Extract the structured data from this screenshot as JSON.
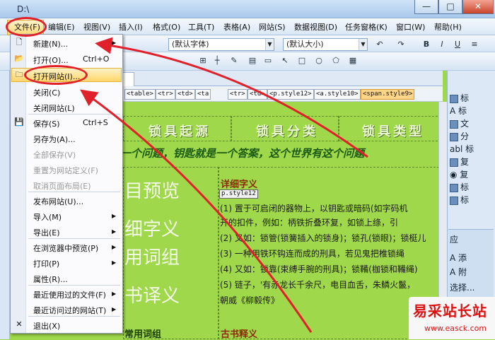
{
  "window": {
    "title": "D:\\",
    "min": "—",
    "max": "□",
    "close": "✕"
  },
  "menu": {
    "file": "文件(F)",
    "edit": "编辑(E)",
    "view": "视图(V)",
    "insert": "插入(I)",
    "format": "格式(O)",
    "tools": "工具(T)",
    "table": "表格(A)",
    "website": "网站(S)",
    "dataview": "数据视图(D)",
    "taskpane": "任务窗格(K)",
    "window": "窗口(W)",
    "help": "帮助(H)"
  },
  "toolbar": {
    "font_default": "(默认字体)",
    "size_default": "(默认大小)",
    "bold": "B",
    "italic": "I",
    "underline": "U"
  },
  "doc_tab": "htm",
  "tags": [
    "<table>",
    "<tr>",
    "<td>",
    "<ta",
    "<tr>",
    "<td>",
    "<p.style12>",
    "<a.style10>",
    "<span.style9>"
  ],
  "page": {
    "headers": [
      "锁具起源",
      "锁具分类",
      "锁具类型"
    ],
    "marquee": "一个问题，钥匙就是一个答案，这个世界有这个问题",
    "left_labels": [
      "目预览",
      "细字义",
      "用词组",
      "书译义",
      "常用词组"
    ],
    "right_title": "详细字义",
    "style_tag": "p.style12",
    "lines": [
      "(1) 置于可启闭的器物上，以钥匙或暗码(如字码机",
      "开的扣件，例如：柄铁折叠环复，如锁上绦，引",
      "(2) 又如：锁管(锁簧插入的锁身)；锁孔(锁眼)；锁梃儿",
      "(3) 一种用铁环钩连而成的刑具，若见鬼把椎锁绳",
      "(4) 又如：锁靠(束缚手腕的刑具)；锁鞴(枷锁和鞴绳)",
      "(5) 链子，'有赤龙长千余尺，电目血舌，朱鳞火鬣，",
      "朝威《柳毅传》"
    ],
    "bottom_title": "古书释义"
  },
  "dock": {
    "items": [
      "标",
      "A 标",
      "文",
      "分",
      "abl 标",
      "复",
      "◉ 复",
      "标",
      "标"
    ],
    "panel2": [
      "应",
      "A 添",
      "A 附",
      "选择..."
    ]
  },
  "file_menu": {
    "new": "新建(N)...",
    "open": "打开(O)...",
    "open_shortcut": "Ctrl+O",
    "open_site": "打开网站(I)...",
    "close": "关闭(C)",
    "close_site": "关闭网站(L)",
    "save": "保存(S)",
    "save_shortcut": "Ctrl+S",
    "save_as": "另存为(A)...",
    "save_all": "全部保存(V)",
    "reset_site": "重置为网站定义(F)",
    "cancel_layout": "取消页面布局(E)",
    "publish": "发布网站(U)...",
    "import": "导入(M)",
    "export": "导出(E)",
    "preview": "在浏览器中预览(P)",
    "print": "打印(P)",
    "props": "属性(R)...",
    "recent_files": "最近使用过的文件(F)",
    "recent_sites": "最近访问过的网站(T)",
    "exit": "退出(X)"
  },
  "watermark": {
    "line1": "易采站长站",
    "line2": "www.easck.com"
  },
  "colors": {
    "accent": "#e0202a",
    "content_bg": "#9fd84a"
  }
}
